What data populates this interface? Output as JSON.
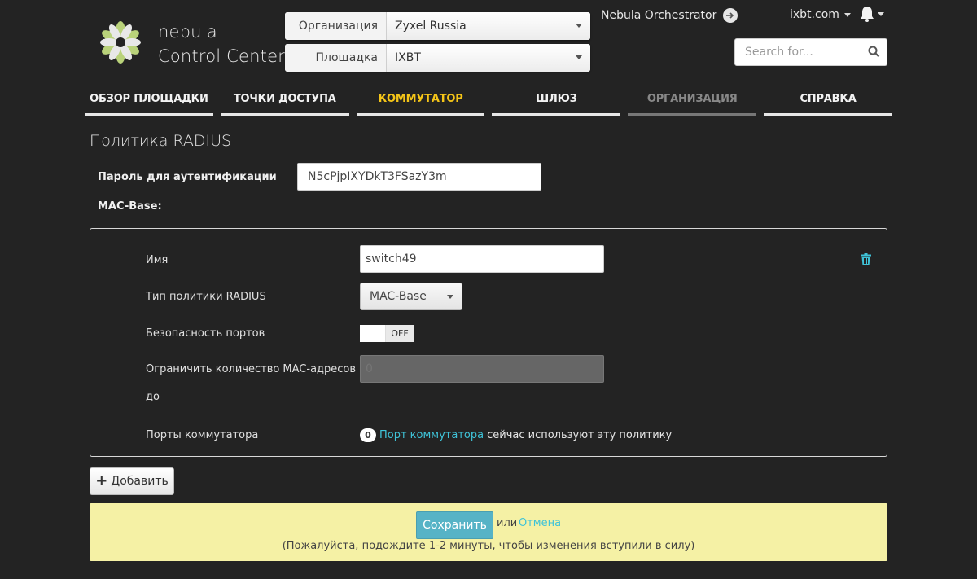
{
  "header": {
    "logo_line1": "nebula",
    "logo_line2": "Control Center",
    "org_label": "Организация",
    "org_value": "Zyxel Russia",
    "site_label": "Площадка",
    "site_value": "IXBT",
    "orchestrator": "Nebula Orchestrator",
    "account": "ixbt.com",
    "search_placeholder": "Search for..."
  },
  "nav": [
    {
      "label": "ОБЗОР ПЛОЩАДКИ",
      "state": "normal"
    },
    {
      "label": "ТОЧКИ ДОСТУПА",
      "state": "normal"
    },
    {
      "label": "КОММУТАТОР",
      "state": "active"
    },
    {
      "label": "ШЛЮЗ",
      "state": "normal"
    },
    {
      "label": "ОРГАНИЗАЦИЯ",
      "state": "dim"
    },
    {
      "label": "СПРАВКА",
      "state": "normal"
    }
  ],
  "page": {
    "title": "Политика RADIUS",
    "auth_label": "Пароль для аутентификации",
    "auth_value": "N5cPjpIXYDkT3FSazY3m",
    "mac_base_label": "MAC-Base:"
  },
  "policy": {
    "name_label": "Имя",
    "name_value": "switch49",
    "type_label": "Тип политики RADIUS",
    "type_value": "MAC-Base",
    "port_security_label": "Безопасность портов",
    "toggle_state": "OFF",
    "limit_label_line1": "Ограничить количество MAC-адресов",
    "limit_label_line2": "до",
    "limit_placeholder": "0",
    "ports_label": "Порты коммутатора",
    "ports_count": "0",
    "ports_link": "Порт коммутатора",
    "ports_text": "сейчас используют эту политику"
  },
  "actions": {
    "add_label": "Добавить",
    "save_label": "Сохранить",
    "or_text": "или",
    "cancel_label": "Отмена",
    "note": "(Пожалуйста, подождите 1-2 минуты, чтобы изменения вступили в силу)"
  },
  "colors": {
    "accent_active_nav": "#f5c518",
    "link": "#3fc3d8",
    "save_button": "#56b3c6",
    "save_bar": "#f5f1a5",
    "background": "#232323"
  }
}
